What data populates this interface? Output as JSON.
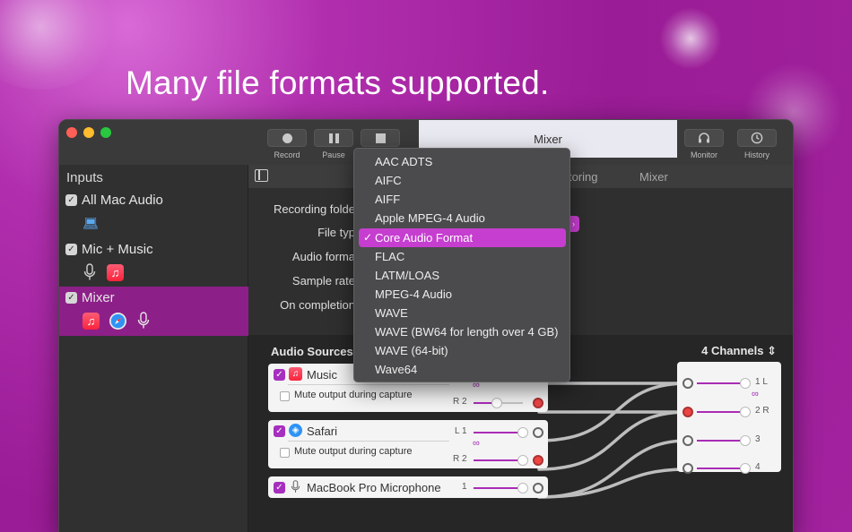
{
  "headline": "Many file formats supported.",
  "toolbar": {
    "record_label": "Record",
    "pause_label": "Pause",
    "monitor_label": "Monitor",
    "history_label": "History",
    "active_tab": "Mixer"
  },
  "sidebar": {
    "title": "Inputs",
    "inputs": [
      {
        "label": "All Mac Audio",
        "checked": true,
        "icons": [
          "laptop-icon"
        ]
      },
      {
        "label": "Mic + Music",
        "checked": true,
        "icons": [
          "mic-icon",
          "music-icon"
        ]
      },
      {
        "label": "Mixer",
        "checked": true,
        "selected": true,
        "icons": [
          "music-icon",
          "safari-icon",
          "mic-icon"
        ]
      }
    ]
  },
  "subtabs": {
    "monitoring": "toring",
    "mixer": "Mixer"
  },
  "settings": {
    "recording_folder": "Recording folde",
    "file_type": "File typ",
    "audio_format": "Audio forma",
    "sample_rate": "Sample rate",
    "on_completion": "On completion"
  },
  "file_type_menu": {
    "items": [
      "AAC ADTS",
      "AIFC",
      "AIFF",
      "Apple MPEG-4 Audio",
      "Core Audio Format",
      "FLAC",
      "LATM/LOAS",
      "MPEG-4 Audio",
      "WAVE",
      "WAVE (BW64 for length over 4 GB)",
      "WAVE (64-bit)",
      "Wave64"
    ],
    "selected": "Core Audio Format",
    "check_glyph": "✓"
  },
  "audio_sources": {
    "title": "Audio Sources",
    "channels": "4 Channels",
    "mute_label": "Mute output during capture",
    "sources": [
      {
        "name": "Music",
        "channels": [
          "R 2"
        ]
      },
      {
        "name": "Safari",
        "channels": [
          "L 1",
          "R 2"
        ]
      },
      {
        "name": "MacBook Pro Microphone",
        "channels": [
          "1"
        ]
      }
    ],
    "outputs": [
      "1 L",
      "2 R",
      "3",
      "4"
    ]
  },
  "colors": {
    "accent": "#c53ecf",
    "background": "#9a1c96",
    "window": "#2b2b2b"
  }
}
